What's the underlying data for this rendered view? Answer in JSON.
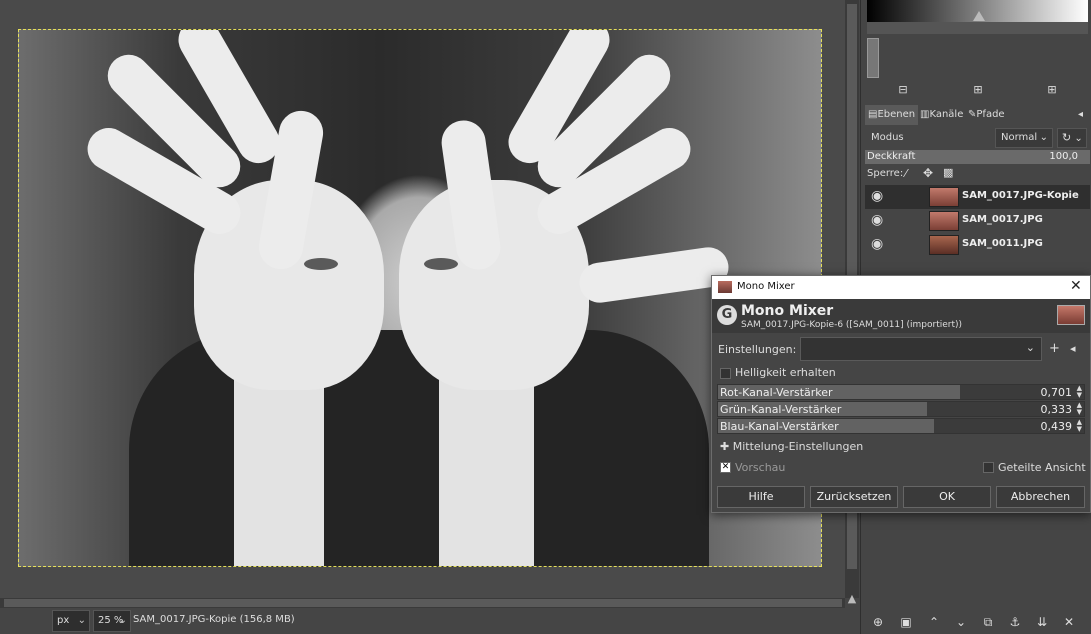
{
  "statusbar": {
    "unit": "px",
    "zoom": "25 %",
    "status_text": "SAM_0017.JPG-Kopie (156,8 MB)"
  },
  "dock": {
    "tabs": [
      {
        "label": "Ebenen",
        "icon": "layers-icon"
      },
      {
        "label": "Kanäle",
        "icon": "channels-icon"
      },
      {
        "label": "Pfade",
        "icon": "paths-icon"
      }
    ],
    "modus_label": "Modus",
    "modus_value": "Normal",
    "opacity_label": "Deckkraft",
    "opacity_value": "100,0",
    "lock_label": "Sperre:",
    "layers": [
      {
        "name": "SAM_0017.JPG-Kopie",
        "selected": true
      },
      {
        "name": "SAM_0017.JPG",
        "selected": false
      },
      {
        "name": "SAM_0011.JPG",
        "selected": false
      }
    ]
  },
  "dialog": {
    "window_title": "Mono Mixer",
    "heading": "Mono Mixer",
    "subtitle": "SAM_0017.JPG-Kopie-6 ([SAM_0011] (importiert))",
    "settings_label": "Einstellungen:",
    "settings_value": "",
    "keep_brightness_label": "Helligkeit erhalten",
    "keep_brightness_checked": false,
    "sliders": [
      {
        "label": "Rot-Kanal-Verstärker",
        "value": "0,701",
        "fraction": 0.66
      },
      {
        "label": "Grün-Kanal-Verstärker",
        "value": "0,333",
        "fraction": 0.57
      },
      {
        "label": "Blau-Kanal-Verstärker",
        "value": "0,439",
        "fraction": 0.59
      }
    ],
    "averaging_label": "Mittelung-Einstellungen",
    "preview_label": "Vorschau",
    "preview_checked": true,
    "split_view_label": "Geteilte Ansicht",
    "split_view_checked": false,
    "buttons": {
      "help": "Hilfe",
      "reset": "Zurücksetzen",
      "ok": "OK",
      "cancel": "Abbrechen"
    }
  }
}
